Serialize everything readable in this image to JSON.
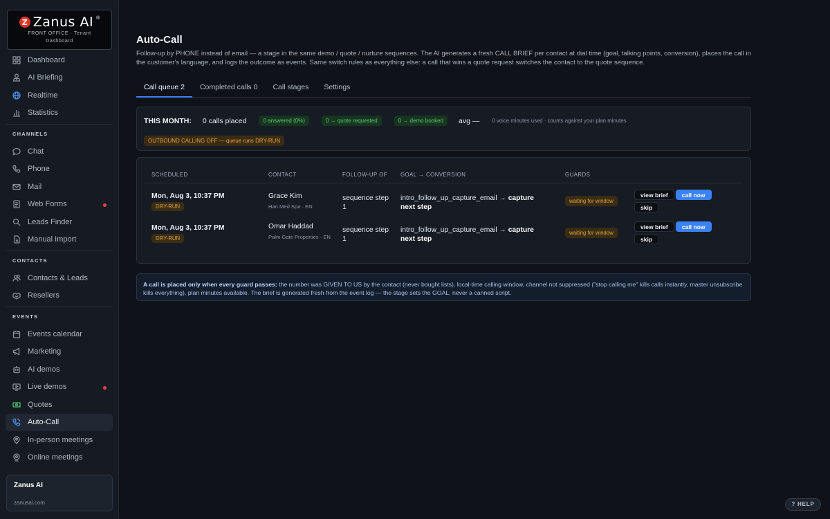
{
  "brand": {
    "logo_text": "Zanus AI",
    "logo_mark": "Z",
    "registered": "®",
    "subtitle_line1": "FRONT OFFICE · Tenant",
    "subtitle_line2": "Dashboard",
    "accent_color": "#e0352b"
  },
  "sidebar": {
    "top_items": [
      {
        "label": "Dashboard",
        "icon": "grid-icon"
      },
      {
        "label": "AI Briefing",
        "icon": "user-tie-icon"
      },
      {
        "label": "Realtime",
        "icon": "globe-icon"
      },
      {
        "label": "Statistics",
        "icon": "bar-chart-icon"
      }
    ],
    "channels_title": "CHANNELS",
    "channels": [
      {
        "label": "Chat",
        "icon": "chat-icon"
      },
      {
        "label": "Phone",
        "icon": "phone-icon"
      },
      {
        "label": "Mail",
        "icon": "mail-icon"
      },
      {
        "label": "Web Forms",
        "icon": "form-icon",
        "dot": true
      },
      {
        "label": "Leads Finder",
        "icon": "search-icon"
      },
      {
        "label": "Manual Import",
        "icon": "import-icon"
      }
    ],
    "contacts_title": "CONTACTS",
    "contacts": [
      {
        "label": "Contacts & Leads",
        "icon": "users-icon"
      },
      {
        "label": "Resellers",
        "icon": "handshake-icon"
      }
    ],
    "events_title": "EVENTS",
    "events": [
      {
        "label": "Events calendar",
        "icon": "calendar-icon"
      },
      {
        "label": "Marketing",
        "icon": "megaphone-icon"
      },
      {
        "label": "AI demos",
        "icon": "robot-icon"
      },
      {
        "label": "Live demos",
        "icon": "video-icon",
        "dot": true
      },
      {
        "label": "Quotes",
        "icon": "money-icon"
      },
      {
        "label": "Auto-Call",
        "icon": "phone-call-icon",
        "active": true
      },
      {
        "label": "In-person meetings",
        "icon": "map-pin-icon"
      },
      {
        "label": "Online meetings",
        "icon": "webcam-icon"
      }
    ],
    "org": {
      "name": "Zanus AI",
      "site": "zanusai.com"
    }
  },
  "page": {
    "title": "Auto-Call",
    "description": "Follow-up by PHONE instead of email — a stage in the same demo / quote / nurture sequences. The AI generates a fresh CALL BRIEF per contact at dial time (goal, talking points, conversion), places the call in the customer's language, and logs the outcome as events. Same switch rules as everything else: a call that wins a quote request switches the contact to the quote sequence."
  },
  "tabs": [
    {
      "label": "Call queue 2",
      "active": true
    },
    {
      "label": "Completed calls 0"
    },
    {
      "label": "Call stages"
    },
    {
      "label": "Settings"
    }
  ],
  "stats": {
    "month_label": "THIS MONTH:",
    "calls_placed": "0 calls placed",
    "answered": "0 answered (0%)",
    "quote_requested": "0 → quote requested",
    "demo_booked": "0 → demo booked",
    "avg": "avg —",
    "minutes_note": "0 voice minutes used · counts against your plan minutes",
    "outbound_status": "OUTBOUND CALLING OFF — queue runs DRY-RUN"
  },
  "queue": {
    "headers": [
      "SCHEDULED",
      "CONTACT",
      "FOLLOW-UP OF",
      "GOAL → CONVERSION",
      "GUARDS"
    ],
    "rows": [
      {
        "scheduled": "Mon, Aug 3, 10:37 PM",
        "mode": "DRY-RUN",
        "contact_name": "Grace Kim",
        "contact_sub": "Han Med Spa · EN",
        "follow_up": "sequence step 1",
        "goal": "intro_follow_up_capture_email →",
        "conversion": "capture next step",
        "guard": "waiting for window"
      },
      {
        "scheduled": "Mon, Aug 3, 10:37 PM",
        "mode": "DRY-RUN",
        "contact_name": "Omar Haddad",
        "contact_sub": "Palm Gate Properties · EN",
        "follow_up": "sequence step 1",
        "goal": "intro_follow_up_capture_email →",
        "conversion": "capture next step",
        "guard": "waiting for window"
      }
    ],
    "actions": {
      "view_brief": "view brief",
      "call_now": "call now",
      "skip": "skip"
    }
  },
  "info": {
    "lead": "A call is placed only when every guard passes:",
    "body": " the number was GIVEN TO US by the contact (never bought lists), local-time calling window, channel not suppressed (\"stop calling me\" kills calls instantly, master unsubscribe kills everything), plan minutes available. The brief is generated fresh from the event log — the stage sets the GOAL, never a canned script."
  },
  "help_label": "? HELP",
  "colors": {
    "primary_blue": "#3b82f6",
    "green": "#56c97a",
    "amber": "#e5a23b",
    "red_dot": "#e5463a"
  }
}
